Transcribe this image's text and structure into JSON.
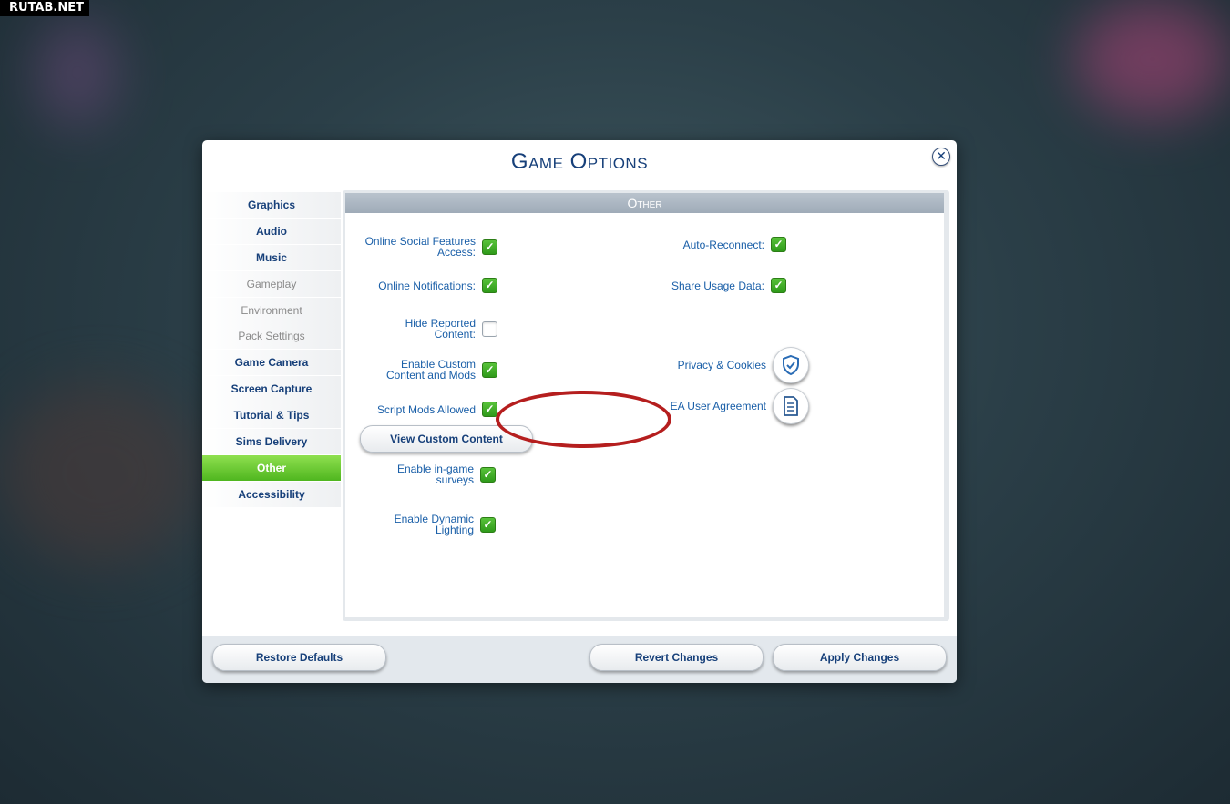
{
  "watermark": "RUTAB.NET",
  "dialog": {
    "title": "Game Options",
    "close_glyph": "✕"
  },
  "sidebar": {
    "items": [
      {
        "label": "Graphics",
        "state": "enabled"
      },
      {
        "label": "Audio",
        "state": "enabled"
      },
      {
        "label": "Music",
        "state": "enabled"
      },
      {
        "label": "Gameplay",
        "state": "disabled"
      },
      {
        "label": "Environment",
        "state": "disabled"
      },
      {
        "label": "Pack Settings",
        "state": "disabled"
      },
      {
        "label": "Game Camera",
        "state": "enabled"
      },
      {
        "label": "Screen Capture",
        "state": "enabled"
      },
      {
        "label": "Tutorial & Tips",
        "state": "enabled"
      },
      {
        "label": "Sims Delivery",
        "state": "enabled"
      },
      {
        "label": "Other",
        "state": "active"
      },
      {
        "label": "Accessibility",
        "state": "enabled"
      }
    ]
  },
  "section": {
    "title": "Other"
  },
  "left_options": {
    "online_social": {
      "label": "Online Social Features Access:",
      "checked": true
    },
    "online_notifications": {
      "label": "Online Notifications:",
      "checked": true
    },
    "hide_reported": {
      "label": "Hide Reported Content:",
      "checked": false
    },
    "enable_custom": {
      "label": "Enable Custom Content and Mods",
      "checked": true
    },
    "script_mods": {
      "label": "Script Mods Allowed",
      "checked": true
    },
    "view_custom_button": "View Custom Content",
    "ingame_surveys": {
      "label": "Enable in-game surveys",
      "checked": true
    },
    "dynamic_lighting": {
      "label": "Enable Dynamic Lighting",
      "checked": true
    }
  },
  "right_options": {
    "auto_reconnect": {
      "label": "Auto-Reconnect:",
      "checked": true
    },
    "share_usage": {
      "label": "Share Usage Data:",
      "checked": true
    },
    "privacy": {
      "label": "Privacy & Cookies",
      "icon": "shield-check-icon"
    },
    "ea_agreement": {
      "label": "EA User Agreement",
      "icon": "document-icon"
    }
  },
  "check_glyph": "✓",
  "footer": {
    "restore": "Restore Defaults",
    "revert": "Revert Changes",
    "apply": "Apply Changes"
  },
  "colors": {
    "title": "#17407a",
    "label": "#1a5fa8",
    "active_tab": "#5fc42a",
    "highlight_ring": "#b51e1e"
  }
}
